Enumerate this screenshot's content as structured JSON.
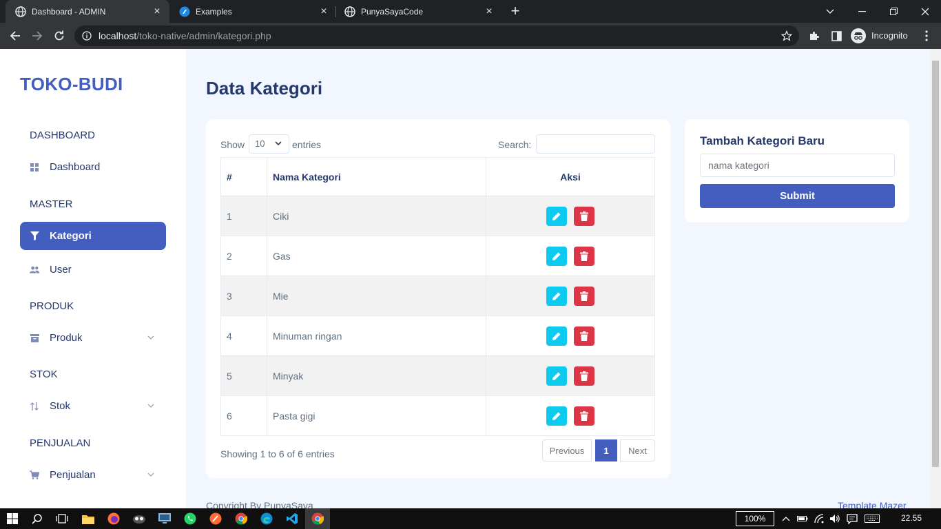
{
  "browser": {
    "tabs": [
      {
        "title": "Dashboard - ADMIN",
        "active": true
      },
      {
        "title": "Examples",
        "active": false
      },
      {
        "title": "PunyaSayaCode",
        "active": false
      }
    ],
    "url_host": "localhost",
    "url_path": "/toko-native/admin/kategori.php",
    "profile_label": "Incognito"
  },
  "sidebar": {
    "brand": "TOKO-BUDI",
    "sections": {
      "dashboard": "DASHBOARD",
      "master": "MASTER",
      "produk": "PRODUK",
      "stok": "STOK",
      "penjualan": "PENJUALAN"
    },
    "items": {
      "dashboard": "Dashboard",
      "kategori": "Kategori",
      "user": "User",
      "produk": "Produk",
      "stok": "Stok",
      "penjualan": "Penjualan"
    }
  },
  "main": {
    "page_title": "Data Kategori",
    "table": {
      "show_label": "Show",
      "entries_value": "10",
      "entries_label": "entries",
      "search_label": "Search:",
      "columns": [
        "#",
        "Nama Kategori",
        "Aksi"
      ],
      "rows": [
        {
          "no": "1",
          "nama": "Ciki"
        },
        {
          "no": "2",
          "nama": "Gas"
        },
        {
          "no": "3",
          "nama": "Mie"
        },
        {
          "no": "4",
          "nama": "Minuman ringan"
        },
        {
          "no": "5",
          "nama": "Minyak"
        },
        {
          "no": "6",
          "nama": "Pasta gigi"
        }
      ],
      "info": "Showing 1 to 6 of 6 entries",
      "pagination": {
        "previous": "Previous",
        "current": "1",
        "next": "Next"
      }
    },
    "form": {
      "title": "Tambah Kategori Baru",
      "placeholder": "nama kategori",
      "submit": "Submit"
    },
    "footer": {
      "left": "Copyright By PunyaSaya",
      "right": "Template Mazer"
    }
  },
  "taskbar": {
    "zoom": "100%",
    "clock": "22.55"
  },
  "colors": {
    "primary": "#435ebe",
    "info": "#0dcaf0",
    "danger": "#dc3545",
    "heading": "#25396f",
    "page_bg": "#f2f7ff"
  }
}
